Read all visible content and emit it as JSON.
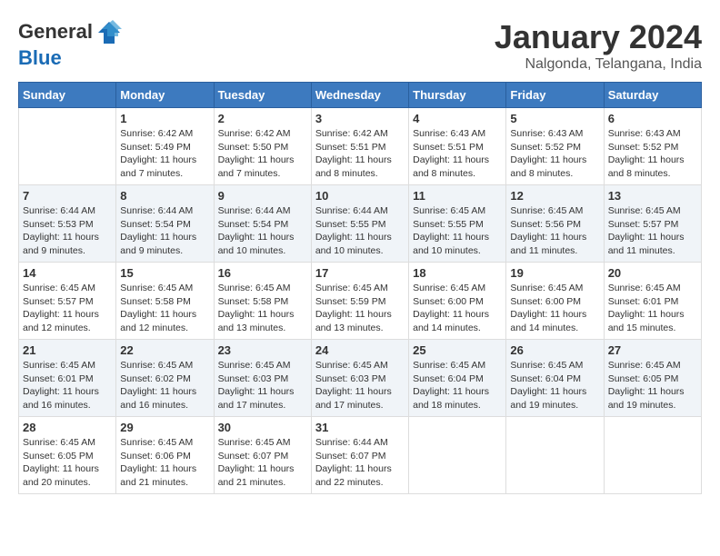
{
  "header": {
    "logo_line1": "General",
    "logo_line2": "Blue",
    "month": "January 2024",
    "location": "Nalgonda, Telangana, India"
  },
  "days_of_week": [
    "Sunday",
    "Monday",
    "Tuesday",
    "Wednesday",
    "Thursday",
    "Friday",
    "Saturday"
  ],
  "weeks": [
    [
      {
        "day": "",
        "details": ""
      },
      {
        "day": "1",
        "details": "Sunrise: 6:42 AM\nSunset: 5:49 PM\nDaylight: 11 hours\nand 7 minutes."
      },
      {
        "day": "2",
        "details": "Sunrise: 6:42 AM\nSunset: 5:50 PM\nDaylight: 11 hours\nand 7 minutes."
      },
      {
        "day": "3",
        "details": "Sunrise: 6:42 AM\nSunset: 5:51 PM\nDaylight: 11 hours\nand 8 minutes."
      },
      {
        "day": "4",
        "details": "Sunrise: 6:43 AM\nSunset: 5:51 PM\nDaylight: 11 hours\nand 8 minutes."
      },
      {
        "day": "5",
        "details": "Sunrise: 6:43 AM\nSunset: 5:52 PM\nDaylight: 11 hours\nand 8 minutes."
      },
      {
        "day": "6",
        "details": "Sunrise: 6:43 AM\nSunset: 5:52 PM\nDaylight: 11 hours\nand 8 minutes."
      }
    ],
    [
      {
        "day": "7",
        "details": "Sunrise: 6:44 AM\nSunset: 5:53 PM\nDaylight: 11 hours\nand 9 minutes."
      },
      {
        "day": "8",
        "details": "Sunrise: 6:44 AM\nSunset: 5:54 PM\nDaylight: 11 hours\nand 9 minutes."
      },
      {
        "day": "9",
        "details": "Sunrise: 6:44 AM\nSunset: 5:54 PM\nDaylight: 11 hours\nand 10 minutes."
      },
      {
        "day": "10",
        "details": "Sunrise: 6:44 AM\nSunset: 5:55 PM\nDaylight: 11 hours\nand 10 minutes."
      },
      {
        "day": "11",
        "details": "Sunrise: 6:45 AM\nSunset: 5:55 PM\nDaylight: 11 hours\nand 10 minutes."
      },
      {
        "day": "12",
        "details": "Sunrise: 6:45 AM\nSunset: 5:56 PM\nDaylight: 11 hours\nand 11 minutes."
      },
      {
        "day": "13",
        "details": "Sunrise: 6:45 AM\nSunset: 5:57 PM\nDaylight: 11 hours\nand 11 minutes."
      }
    ],
    [
      {
        "day": "14",
        "details": "Sunrise: 6:45 AM\nSunset: 5:57 PM\nDaylight: 11 hours\nand 12 minutes."
      },
      {
        "day": "15",
        "details": "Sunrise: 6:45 AM\nSunset: 5:58 PM\nDaylight: 11 hours\nand 12 minutes."
      },
      {
        "day": "16",
        "details": "Sunrise: 6:45 AM\nSunset: 5:58 PM\nDaylight: 11 hours\nand 13 minutes."
      },
      {
        "day": "17",
        "details": "Sunrise: 6:45 AM\nSunset: 5:59 PM\nDaylight: 11 hours\nand 13 minutes."
      },
      {
        "day": "18",
        "details": "Sunrise: 6:45 AM\nSunset: 6:00 PM\nDaylight: 11 hours\nand 14 minutes."
      },
      {
        "day": "19",
        "details": "Sunrise: 6:45 AM\nSunset: 6:00 PM\nDaylight: 11 hours\nand 14 minutes."
      },
      {
        "day": "20",
        "details": "Sunrise: 6:45 AM\nSunset: 6:01 PM\nDaylight: 11 hours\nand 15 minutes."
      }
    ],
    [
      {
        "day": "21",
        "details": "Sunrise: 6:45 AM\nSunset: 6:01 PM\nDaylight: 11 hours\nand 16 minutes."
      },
      {
        "day": "22",
        "details": "Sunrise: 6:45 AM\nSunset: 6:02 PM\nDaylight: 11 hours\nand 16 minutes."
      },
      {
        "day": "23",
        "details": "Sunrise: 6:45 AM\nSunset: 6:03 PM\nDaylight: 11 hours\nand 17 minutes."
      },
      {
        "day": "24",
        "details": "Sunrise: 6:45 AM\nSunset: 6:03 PM\nDaylight: 11 hours\nand 17 minutes."
      },
      {
        "day": "25",
        "details": "Sunrise: 6:45 AM\nSunset: 6:04 PM\nDaylight: 11 hours\nand 18 minutes."
      },
      {
        "day": "26",
        "details": "Sunrise: 6:45 AM\nSunset: 6:04 PM\nDaylight: 11 hours\nand 19 minutes."
      },
      {
        "day": "27",
        "details": "Sunrise: 6:45 AM\nSunset: 6:05 PM\nDaylight: 11 hours\nand 19 minutes."
      }
    ],
    [
      {
        "day": "28",
        "details": "Sunrise: 6:45 AM\nSunset: 6:05 PM\nDaylight: 11 hours\nand 20 minutes."
      },
      {
        "day": "29",
        "details": "Sunrise: 6:45 AM\nSunset: 6:06 PM\nDaylight: 11 hours\nand 21 minutes."
      },
      {
        "day": "30",
        "details": "Sunrise: 6:45 AM\nSunset: 6:07 PM\nDaylight: 11 hours\nand 21 minutes."
      },
      {
        "day": "31",
        "details": "Sunrise: 6:44 AM\nSunset: 6:07 PM\nDaylight: 11 hours\nand 22 minutes."
      },
      {
        "day": "",
        "details": ""
      },
      {
        "day": "",
        "details": ""
      },
      {
        "day": "",
        "details": ""
      }
    ]
  ]
}
